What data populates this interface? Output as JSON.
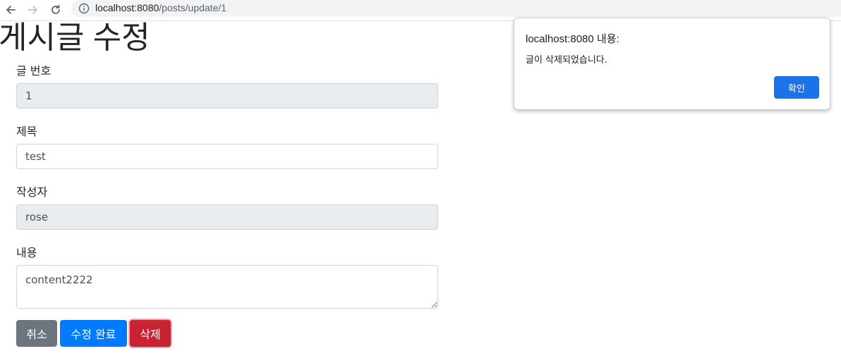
{
  "browser": {
    "url_host": "localhost:8080",
    "url_path": "/posts/update/1",
    "icons": {
      "back": "arrow-left-icon",
      "forward": "arrow-right-icon",
      "reload": "reload-icon",
      "site_info": "info-icon"
    }
  },
  "page": {
    "title": "게시글 수정"
  },
  "form": {
    "id": {
      "label": "글 번호",
      "value": "1"
    },
    "title": {
      "label": "제목",
      "value": "test"
    },
    "author": {
      "label": "작성자",
      "value": "rose"
    },
    "content": {
      "label": "내용",
      "value": "content2222"
    }
  },
  "buttons": {
    "cancel": "취소",
    "update": "수정 완료",
    "delete": "삭제"
  },
  "dialog": {
    "title": "localhost:8080 내용:",
    "message": "글이 삭제되었습니다.",
    "ok_label": "확인",
    "accent": "#1a73e8"
  },
  "colors": {
    "secondary": "#6c757d",
    "primary": "#007bff",
    "danger": "#c82333"
  }
}
